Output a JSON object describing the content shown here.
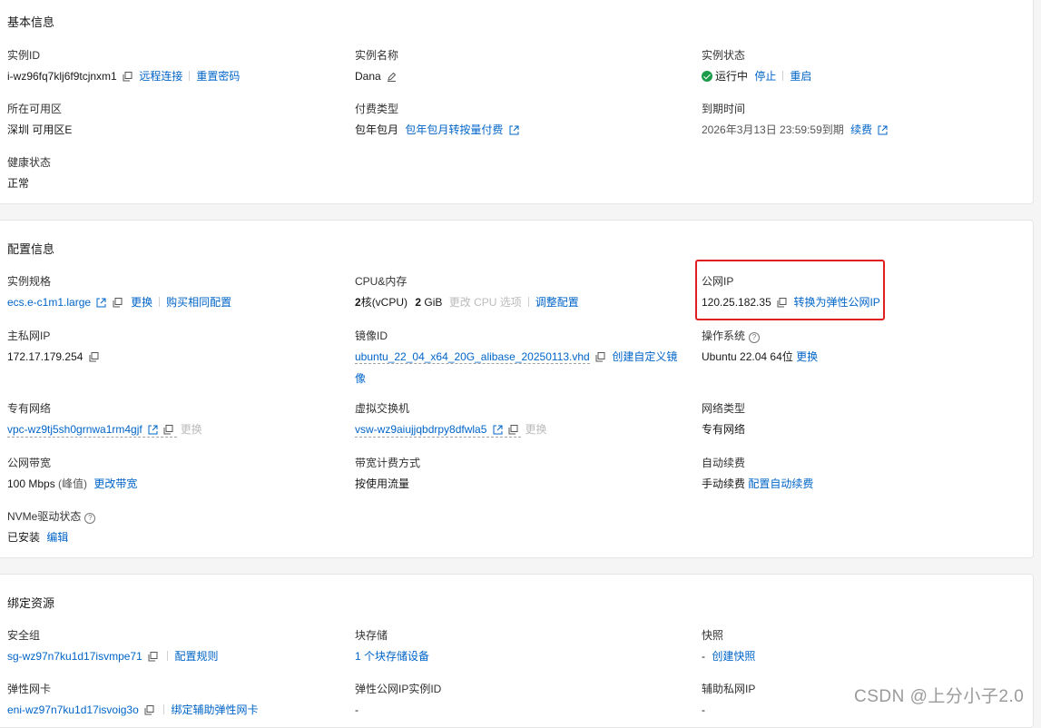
{
  "basic": {
    "title": "基本信息",
    "instance_id_label": "实例ID",
    "instance_id": "i-wz96fq7klj6f9tcjnxm1",
    "remote_connect": "远程连接",
    "reset_password": "重置密码",
    "instance_name_label": "实例名称",
    "instance_name": "Dana",
    "status_label": "实例状态",
    "status": "运行中",
    "stop": "停止",
    "restart": "重启",
    "zone_label": "所在可用区",
    "zone": "深圳 可用区E",
    "billing_label": "付费类型",
    "billing": "包年包月",
    "billing_convert": "包年包月转按量付费",
    "expire_label": "到期时间",
    "expire": "2026年3月13日 23:59:59到期",
    "renew": "续费",
    "health_label": "健康状态",
    "health": "正常"
  },
  "config": {
    "title": "配置信息",
    "spec_label": "实例规格",
    "spec": "ecs.e-c1m1.large",
    "spec_change": "更换",
    "spec_buy": "购买相同配置",
    "cpu_label": "CPU&内存",
    "cpu_num": "2",
    "cpu_unit": "核(vCPU)",
    "mem_num": "2",
    "mem_unit": "GiB",
    "cpu_change_options": "更改 CPU 选项",
    "adjust_config": "调整配置",
    "public_ip_label": "公网IP",
    "public_ip": "120.25.182.35",
    "convert_eip": "转换为弹性公网IP",
    "private_ip_label": "主私网IP",
    "private_ip": "172.17.179.254",
    "image_label": "镜像ID",
    "image": "ubuntu_22_04_x64_20G_alibase_20250113.vhd",
    "create_image": "创建自定义镜",
    "create_image_2": "像",
    "os_label": "操作系统",
    "os": "Ubuntu 22.04 64位",
    "os_change": "更换",
    "vpc_label": "专有网络",
    "vpc": "vpc-wz9tj5sh0grnwa1rm4gjf",
    "vpc_change": "更换",
    "vswitch_label": "虚拟交换机",
    "vswitch": "vsw-wz9aiujjqbdrpy8dfwla5",
    "vswitch_change": "更换",
    "net_type_label": "网络类型",
    "net_type": "专有网络",
    "bandwidth_label": "公网带宽",
    "bandwidth": "100 Mbps",
    "bandwidth_peak": "(峰值)",
    "bandwidth_change": "更改带宽",
    "bw_billing_label": "带宽计费方式",
    "bw_billing": "按使用流量",
    "auto_renew_label": "自动续费",
    "auto_renew": "手动续费",
    "auto_renew_config": "配置自动续费",
    "nvme_label": "NVMe驱动状态",
    "nvme": "已安装",
    "nvme_edit": "编辑"
  },
  "bind": {
    "title": "绑定资源",
    "sg_label": "安全组",
    "sg": "sg-wz97n7ku1d17isvmpe71",
    "sg_rules": "配置规则",
    "disk_label": "块存储",
    "disk": "1 个块存储设备",
    "snapshot_label": "快照",
    "snapshot_dash": "-",
    "snapshot_create": "创建快照",
    "eni_label": "弹性网卡",
    "eni": "eni-wz97n7ku1d17isvoig3o",
    "eni_bind": "绑定辅助弹性网卡",
    "eip_label": "弹性公网IP实例ID",
    "eip": "-",
    "secondary_ip_label": "辅助私网IP",
    "secondary_ip": "-"
  },
  "watermark": "CSDN @上分小子2.0",
  "colors": {
    "link": "#0064c8",
    "success": "#1a9c4b",
    "highlight": "#e02020"
  }
}
